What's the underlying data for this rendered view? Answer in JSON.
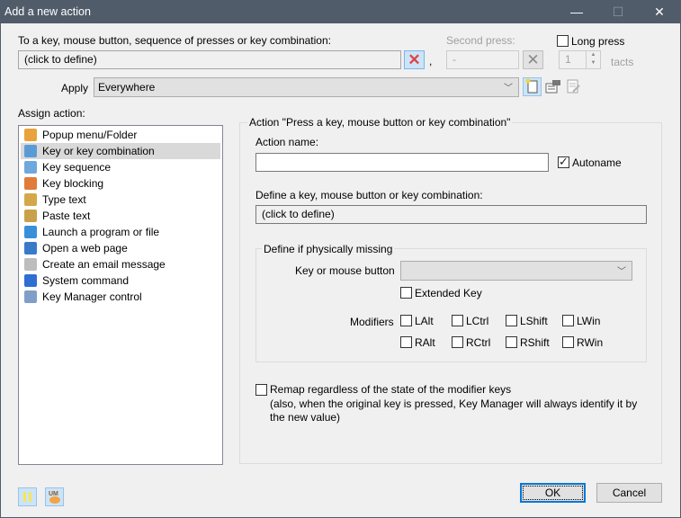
{
  "window": {
    "title": "Add a new action",
    "controls": {
      "minimize": "—",
      "maximize": "☐",
      "close": "✕"
    }
  },
  "trigger": {
    "label": "To a key, mouse button, sequence of presses or key combination:",
    "value": "(click to define)",
    "clear_icon": "red-x-icon",
    "separator": ",",
    "second_press_label": "Second press:",
    "second_press_value": "-",
    "long_press_label": "Long press",
    "long_press_checked": false,
    "tacts_value": "1",
    "tacts_label": "tacts"
  },
  "apply": {
    "label": "Apply",
    "selected": "Everywhere",
    "tool_icons": [
      "new-page-icon",
      "properties-icon",
      "edit-page-icon"
    ]
  },
  "assign": {
    "label": "Assign action:",
    "items": [
      {
        "label": "Popup menu/Folder",
        "icon": "folder-menu-icon",
        "color": "#e8a33c"
      },
      {
        "label": "Key or key combination",
        "icon": "key-icon",
        "color": "#5b9bd5",
        "selected": true
      },
      {
        "label": "Key sequence",
        "icon": "key-sequence-icon",
        "color": "#6fa8dc"
      },
      {
        "label": "Key blocking",
        "icon": "lock-key-icon",
        "color": "#e07b39"
      },
      {
        "label": "Type text",
        "icon": "clipboard-type-icon",
        "color": "#d4a84a"
      },
      {
        "label": "Paste text",
        "icon": "clipboard-paste-icon",
        "color": "#c9a14a"
      },
      {
        "label": "Launch a program or file",
        "icon": "program-window-icon",
        "color": "#3a8fd9"
      },
      {
        "label": "Open a web page",
        "icon": "globe-icon",
        "color": "#3a7bc8"
      },
      {
        "label": "Create an email message",
        "icon": "envelope-icon",
        "color": "#bdbdbd"
      },
      {
        "label": "System command",
        "icon": "monitor-check-icon",
        "color": "#2e6fd1"
      },
      {
        "label": "Key Manager control",
        "icon": "key-manager-icon",
        "color": "#7f9fc8"
      }
    ]
  },
  "action": {
    "group_title": "Action \"Press a key, mouse button or key combination\"",
    "name_label": "Action name:",
    "name_value": "",
    "autoname_label": "Autoname",
    "autoname_checked": true,
    "define_label": "Define a key, mouse button or key combination:",
    "define_value": "(click to define)",
    "missing": {
      "group_title": "Define if physically missing",
      "key_label": "Key or mouse button",
      "key_value": "",
      "extended_label": "Extended Key",
      "modifiers_label": "Modifiers",
      "modifiers": [
        {
          "label": "LAlt",
          "checked": false
        },
        {
          "label": "LCtrl",
          "checked": false
        },
        {
          "label": "LShift",
          "checked": false
        },
        {
          "label": "LWin",
          "checked": false
        },
        {
          "label": "RAlt",
          "checked": false
        },
        {
          "label": "RCtrl",
          "checked": false
        },
        {
          "label": "RShift",
          "checked": false
        },
        {
          "label": "RWin",
          "checked": false
        }
      ]
    },
    "remap_label": "Remap regardless of the state of the modifier keys",
    "remap_note_1": "(also, when the original key is pressed, Key Manager will always identify it by",
    "remap_note_2": "the new value)"
  },
  "footer": {
    "pause_icon": "pause-icon",
    "km_icon": "key-manager-logo-icon",
    "km_text": "UM",
    "ok_label": "OK",
    "cancel_label": "Cancel"
  }
}
